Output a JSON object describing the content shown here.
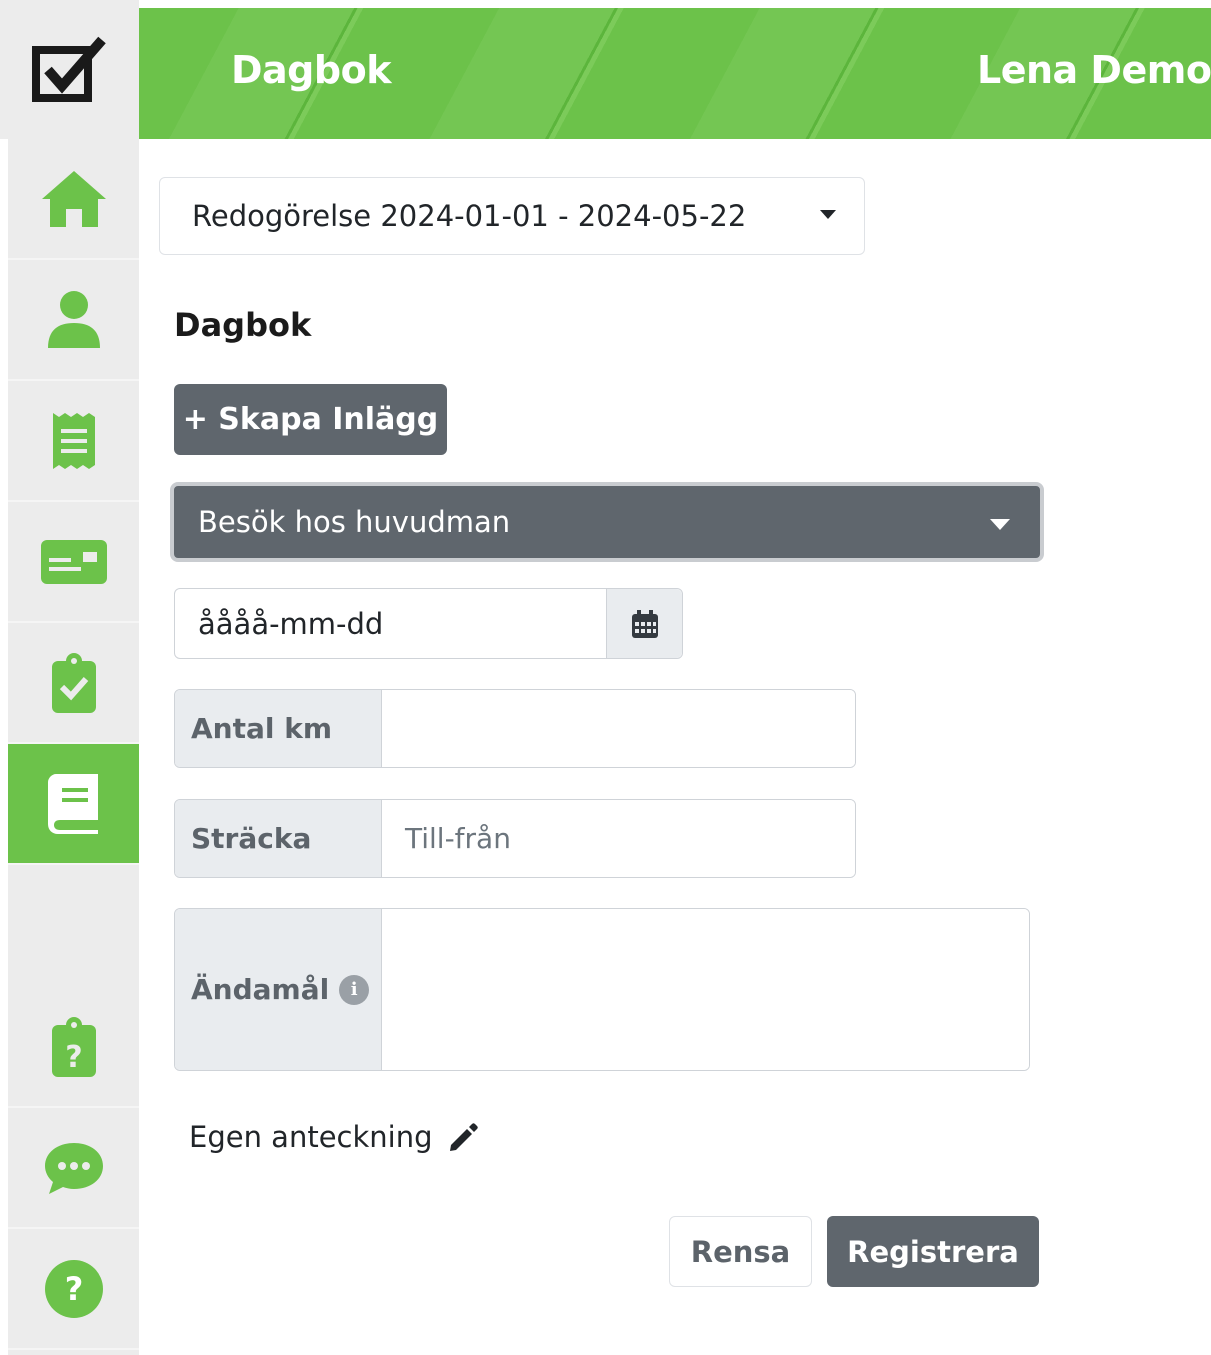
{
  "header": {
    "title": "Dagbok",
    "user_name": "Lena Demo"
  },
  "colors": {
    "brand_green": "#6cc24a",
    "button_gray": "#5f666d",
    "sidebar_bg": "#ececec"
  },
  "sidebar": {
    "items": [
      {
        "icon": "home-icon"
      },
      {
        "icon": "user-icon"
      },
      {
        "icon": "receipt-icon"
      },
      {
        "icon": "id-card-icon"
      },
      {
        "icon": "clipboard-check-icon"
      },
      {
        "icon": "book-icon",
        "active": true
      },
      {
        "icon": "clipboard-question-icon"
      },
      {
        "icon": "chat-icon"
      },
      {
        "icon": "help-icon"
      }
    ]
  },
  "period_select": {
    "value": "Redogörelse 2024-01-01 - 2024-05-22"
  },
  "main": {
    "section_title": "Dagbok",
    "create_button": "+ Skapa Inlägg",
    "type_select": {
      "value": "Besök hos huvudman"
    },
    "date_field": {
      "placeholder": "åååå-mm-dd"
    },
    "km_field": {
      "label": "Antal km",
      "value": ""
    },
    "route_field": {
      "label": "Sträcka",
      "placeholder": "Till-från"
    },
    "purpose_field": {
      "label": "Ändamål",
      "value": ""
    },
    "own_note_link": "Egen anteckning",
    "clear_button": "Rensa",
    "submit_button": "Registrera"
  }
}
